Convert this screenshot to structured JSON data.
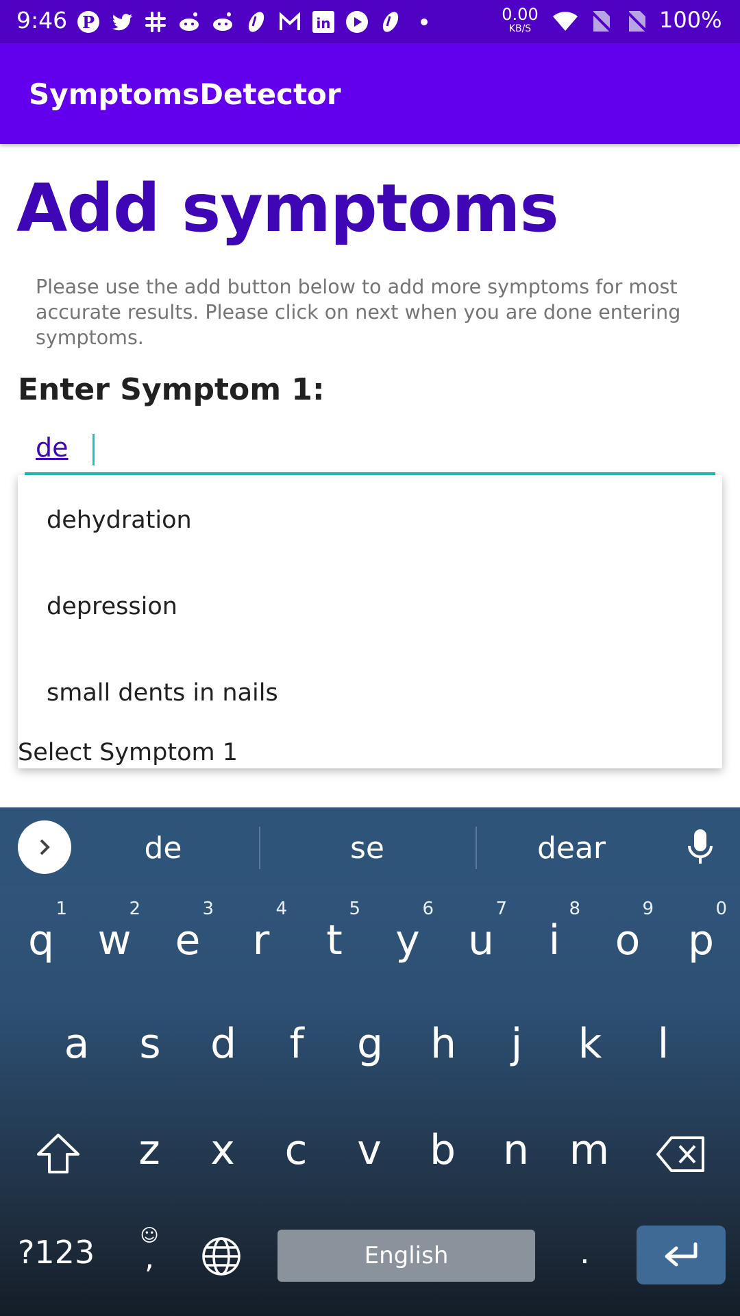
{
  "status_bar": {
    "time": "9:46",
    "net_speed_value": "0.00",
    "net_speed_unit": "KB/S",
    "battery": "100%",
    "notification_icons": [
      "pinterest-icon",
      "twitter-icon",
      "slack-icon",
      "reddit-icon",
      "reddit-icon",
      "app-icon",
      "gmail-icon",
      "linkedin-icon",
      "youtube-icon",
      "app-icon",
      "dot-icon"
    ],
    "system_icons": [
      "wifi-icon",
      "no-sim-icon",
      "no-sim-icon"
    ]
  },
  "app_bar": {
    "title": "SymptomsDetector"
  },
  "content": {
    "title": "Add symptoms",
    "description": "Please use the add button below to add more symptoms for most accurate results. Please click on next when you are done entering symptoms.",
    "symptom_label": "Enter Symptom 1:",
    "symptom_input_value": "de",
    "select_label": "Select Symptom 1"
  },
  "dropdown": {
    "items": [
      "dehydration",
      "depression",
      "small dents in nails"
    ]
  },
  "keyboard": {
    "suggestions": [
      "de",
      "se",
      "dear"
    ],
    "row1": [
      {
        "key": "q",
        "hint": "1"
      },
      {
        "key": "w",
        "hint": "2"
      },
      {
        "key": "e",
        "hint": "3"
      },
      {
        "key": "r",
        "hint": "4"
      },
      {
        "key": "t",
        "hint": "5"
      },
      {
        "key": "y",
        "hint": "6"
      },
      {
        "key": "u",
        "hint": "7"
      },
      {
        "key": "i",
        "hint": "8"
      },
      {
        "key": "o",
        "hint": "9"
      },
      {
        "key": "p",
        "hint": "0"
      }
    ],
    "row2": [
      "a",
      "s",
      "d",
      "f",
      "g",
      "h",
      "j",
      "k",
      "l"
    ],
    "row3": [
      "z",
      "x",
      "c",
      "v",
      "b",
      "n",
      "m"
    ],
    "symbols_label": "?123",
    "emoji_label": "☺",
    "comma_label": ",",
    "space_label": "English",
    "period_label": "."
  },
  "colors": {
    "status_bar": "#4f02c4",
    "app_bar": "#6200ee",
    "title": "#3f06b5",
    "accent": "#1bc4b8"
  }
}
